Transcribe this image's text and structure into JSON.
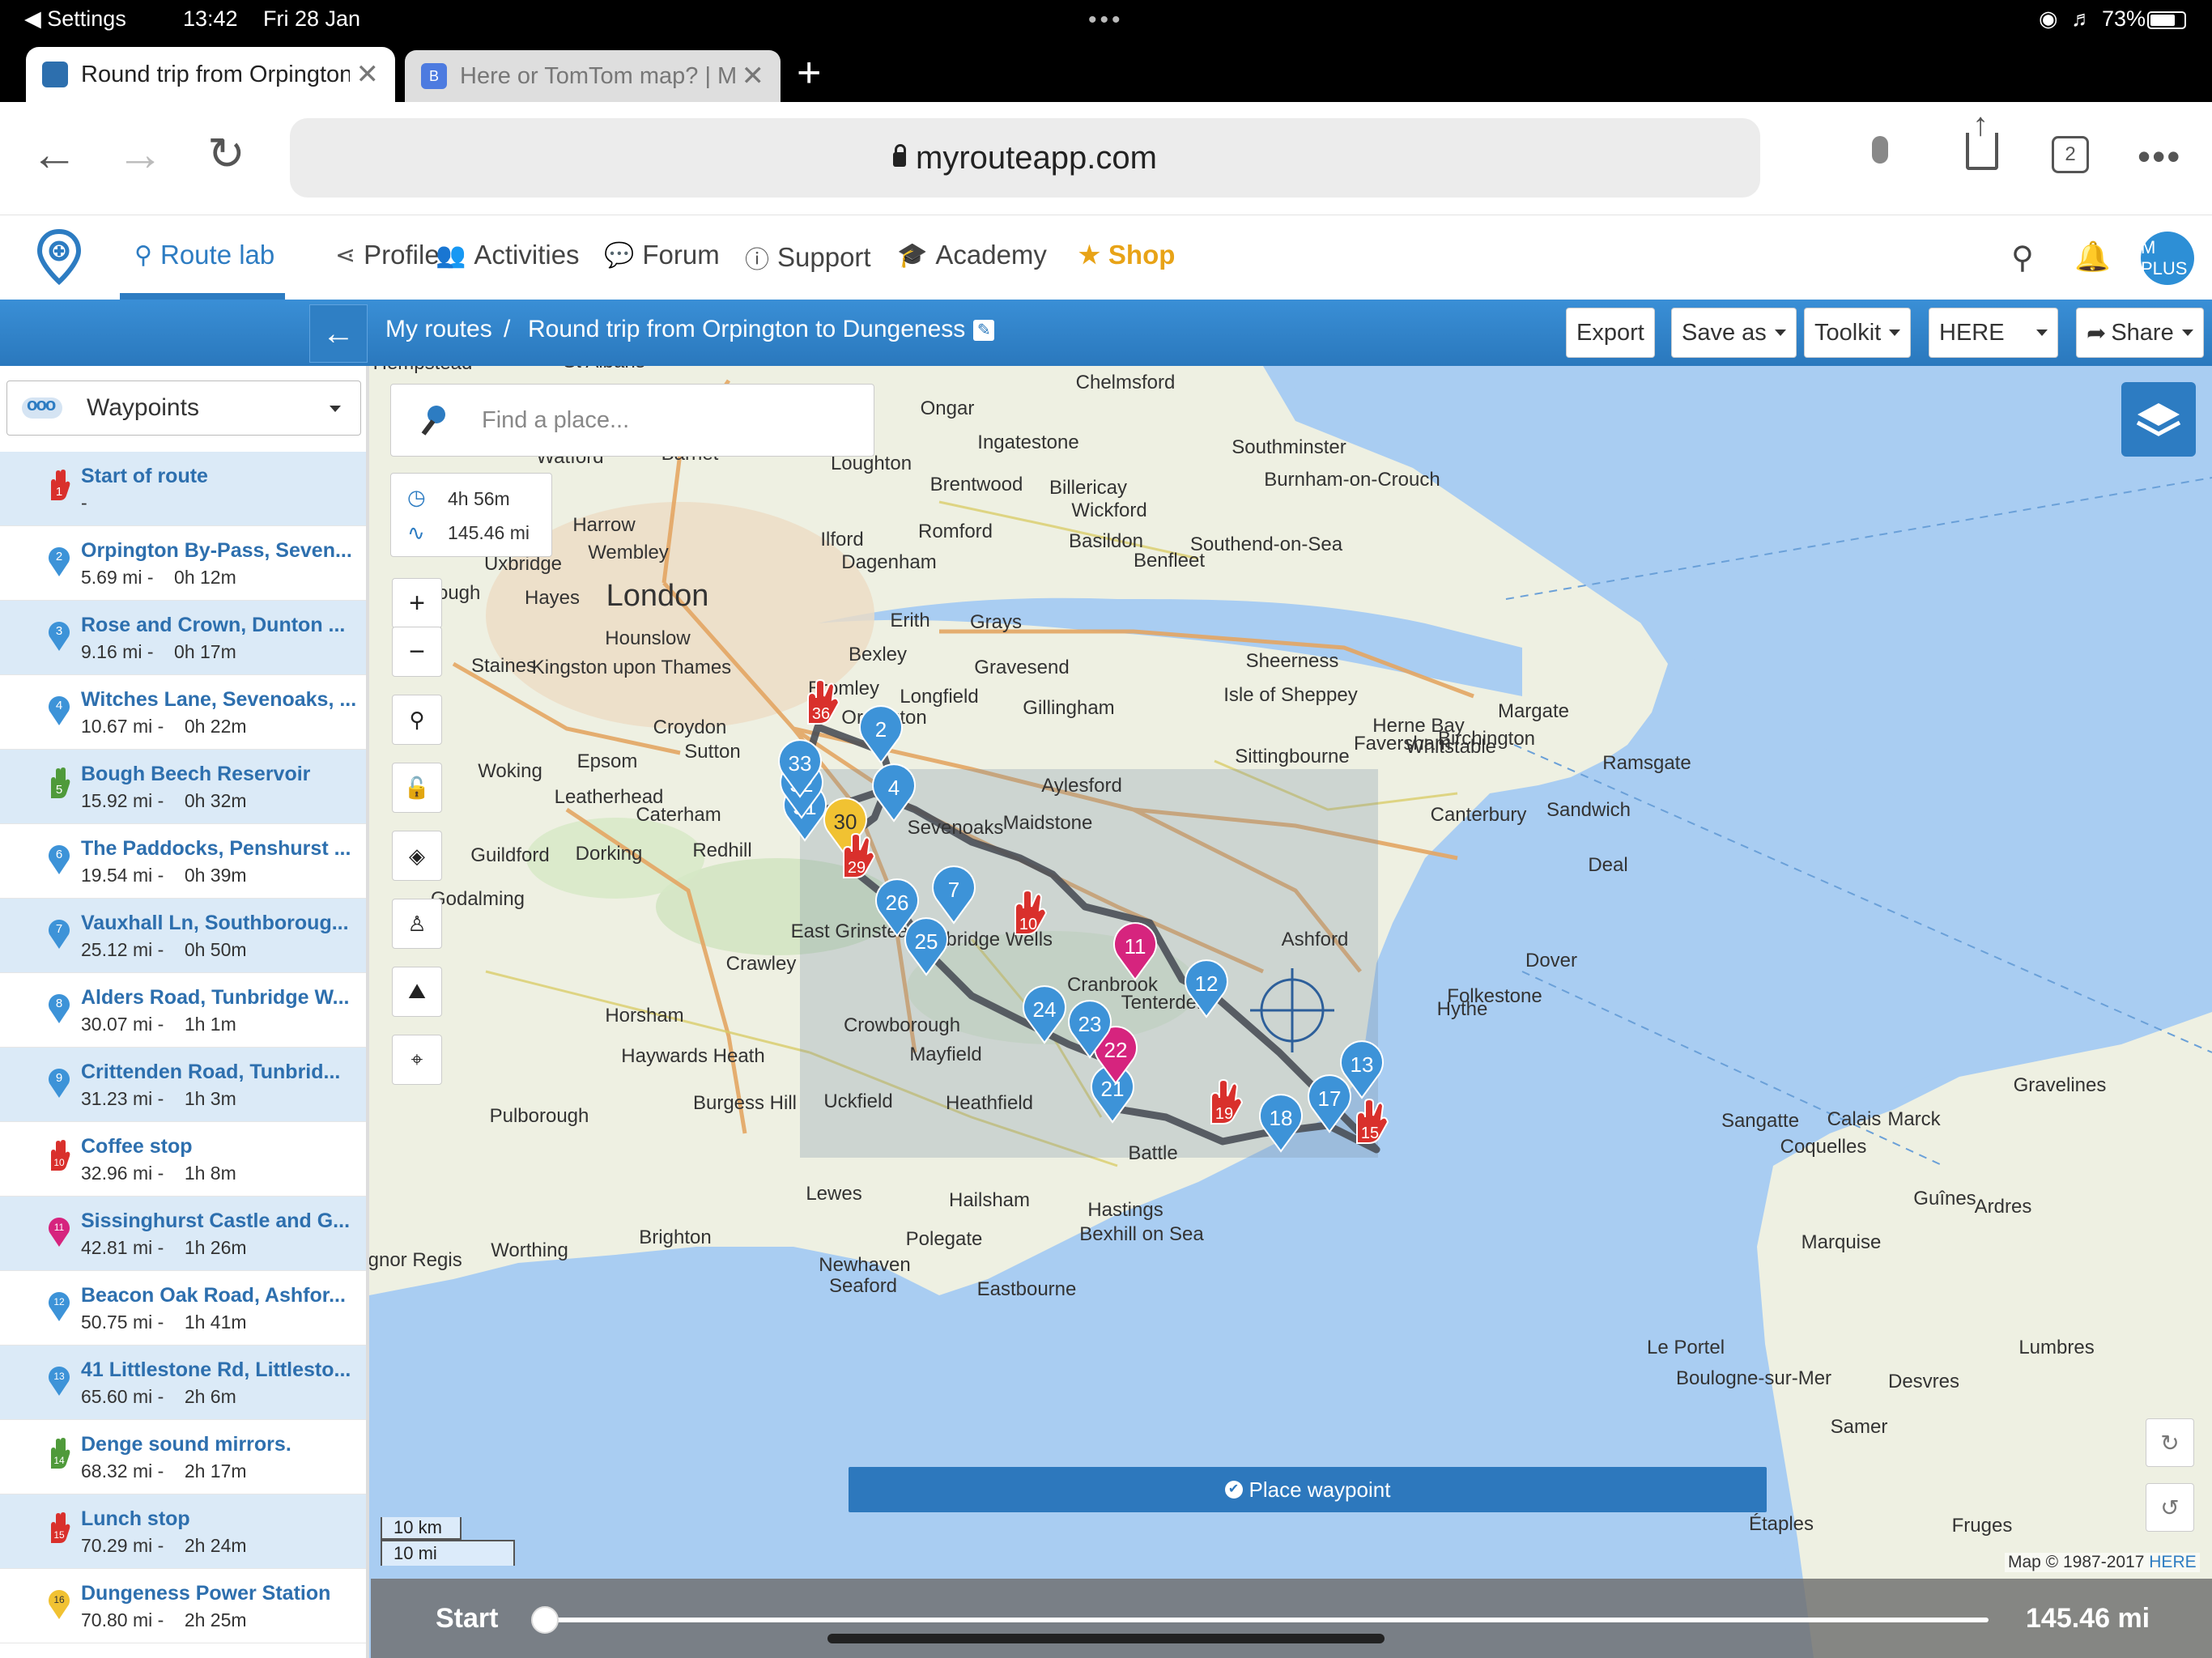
{
  "status_bar": {
    "back_app": "◀ Settings",
    "time": "13:42",
    "date": "Fri 28 Jan",
    "battery": "73%"
  },
  "browser_tabs": [
    {
      "title": "Round trip from Orpington",
      "active": true
    },
    {
      "title": "Here or TomTom map? | M",
      "active": false
    }
  ],
  "browser": {
    "url": "myrouteapp.com",
    "tab_count": "2"
  },
  "nav": {
    "items": [
      {
        "label": "Route lab",
        "icon": "map-pin-icon",
        "active": true
      },
      {
        "label": "Profile",
        "icon": "share-icon"
      },
      {
        "label": "Activities",
        "icon": "users-icon"
      },
      {
        "label": "Forum",
        "icon": "comments-icon"
      },
      {
        "label": "Support",
        "icon": "info-icon"
      },
      {
        "label": "Academy",
        "icon": "graduation-cap-icon"
      },
      {
        "label": "Shop",
        "icon": "star-icon",
        "accent": "#e8a317"
      }
    ],
    "avatar_text": "M PLUS"
  },
  "routebar": {
    "breadcrumb_root": "My routes",
    "separator": "/",
    "route_name": "Round trip from Orpington to Dungeness",
    "buttons": {
      "export": "Export",
      "save_as": "Save as",
      "toolkit": "Toolkit",
      "map_provider": "HERE",
      "share": "Share"
    }
  },
  "sidebar": {
    "dropdown_label": "Waypoints",
    "waypoints": [
      {
        "num": "1",
        "type": "hand",
        "color": "#d9302c",
        "title": "Start of route",
        "sub": "-"
      },
      {
        "num": "2",
        "type": "pin",
        "color": "#3d93d8",
        "title": "Orpington By-Pass, Seven...",
        "sub": "5.69 mi -    0h 12m"
      },
      {
        "num": "3",
        "type": "pin",
        "color": "#3d93d8",
        "title": "Rose and Crown, Dunton ...",
        "sub": "9.16 mi -    0h 17m"
      },
      {
        "num": "4",
        "type": "pin",
        "color": "#3d93d8",
        "title": "Witches Lane, Sevenoaks, ...",
        "sub": "10.67 mi -    0h 22m"
      },
      {
        "num": "5",
        "type": "hand",
        "color": "#4f9a3a",
        "title": "Bough Beech Reservoir",
        "sub": "15.92 mi -    0h 32m"
      },
      {
        "num": "6",
        "type": "pin",
        "color": "#3d93d8",
        "title": "The Paddocks, Penshurst ...",
        "sub": "19.54 mi -    0h 39m"
      },
      {
        "num": "7",
        "type": "pin",
        "color": "#3d93d8",
        "title": "Vauxhall Ln, Southboroug...",
        "sub": "25.12 mi -    0h 50m"
      },
      {
        "num": "8",
        "type": "pin",
        "color": "#3d93d8",
        "title": "Alders Road, Tunbridge W...",
        "sub": "30.07 mi -    1h 1m"
      },
      {
        "num": "9",
        "type": "pin",
        "color": "#3d93d8",
        "title": "Crittenden Road, Tunbrid...",
        "sub": "31.23 mi -    1h 3m"
      },
      {
        "num": "10",
        "type": "hand",
        "color": "#d9302c",
        "title": "Coffee stop",
        "sub": "32.96 mi -    1h 8m"
      },
      {
        "num": "11",
        "type": "pin",
        "color": "#d6247e",
        "title": "Sissinghurst Castle and G...",
        "sub": "42.81 mi -    1h 26m"
      },
      {
        "num": "12",
        "type": "pin",
        "color": "#3d93d8",
        "title": "Beacon Oak Road, Ashfor...",
        "sub": "50.75 mi -    1h 41m"
      },
      {
        "num": "13",
        "type": "pin",
        "color": "#3d93d8",
        "title": "41 Littlestone Rd, Littlesto...",
        "sub": "65.60 mi -    2h 6m"
      },
      {
        "num": "14",
        "type": "hand",
        "color": "#4f9a3a",
        "title": "Denge sound mirrors.",
        "sub": "68.32 mi -    2h 17m"
      },
      {
        "num": "15",
        "type": "hand",
        "color": "#d9302c",
        "title": "Lunch stop",
        "sub": "70.29 mi -    2h 24m"
      },
      {
        "num": "16",
        "type": "pin",
        "color": "#f1c232",
        "title": "Dungeness Power Station",
        "sub": "70.80 mi -    2h 25m"
      }
    ]
  },
  "map": {
    "search_placeholder": "Find a place...",
    "duration": "4h 56m",
    "distance": "145.46 mi",
    "zoom_in": "+",
    "zoom_out": "−",
    "place_waypoint": "Place waypoint",
    "scale_km": "10 km",
    "scale_mi": "10 mi",
    "copyright_prefix": "Map © 1987-2017",
    "copyright_brand": "HERE",
    "places": [
      {
        "name": "Chelmsford",
        "big": false
      },
      {
        "name": "London",
        "big": true
      },
      {
        "name": "Hounslow",
        "big": false
      },
      {
        "name": "Croydon",
        "big": false
      },
      {
        "name": "Sutton",
        "big": false
      },
      {
        "name": "Bexley",
        "big": false
      },
      {
        "name": "Romford",
        "big": false
      },
      {
        "name": "Basildon",
        "big": false
      },
      {
        "name": "Southend-on-Sea",
        "big": false
      },
      {
        "name": "Maidstone",
        "big": false
      },
      {
        "name": "Sevenoaks",
        "big": false
      },
      {
        "name": "Tunbridge Wells",
        "big": false
      },
      {
        "name": "Ashford",
        "big": false
      },
      {
        "name": "Canterbury",
        "big": false
      },
      {
        "name": "Dover",
        "big": false
      },
      {
        "name": "Folkestone",
        "big": false
      },
      {
        "name": "Margate",
        "big": false
      },
      {
        "name": "Ramsgate",
        "big": false
      },
      {
        "name": "Guildford",
        "big": false
      },
      {
        "name": "Crawley",
        "big": false
      },
      {
        "name": "Horsham",
        "big": false
      },
      {
        "name": "Brighton",
        "big": false
      },
      {
        "name": "Worthing",
        "big": false
      },
      {
        "name": "Eastbourne",
        "big": false
      },
      {
        "name": "Hastings",
        "big": false
      },
      {
        "name": "Bexhill on Sea",
        "big": false
      },
      {
        "name": "Calais",
        "big": false
      },
      {
        "name": "Woking",
        "big": false
      },
      {
        "name": "Gravesend",
        "big": false
      },
      {
        "name": "Sittingbourne",
        "big": false
      },
      {
        "name": "Faversham",
        "big": false
      },
      {
        "name": "Deal",
        "big": false
      },
      {
        "name": "Hythe",
        "big": false
      },
      {
        "name": "Battle",
        "big": false
      },
      {
        "name": "Lewes",
        "big": false
      },
      {
        "name": "Hailsham",
        "big": false
      },
      {
        "name": "Heathfield",
        "big": false
      },
      {
        "name": "Crowborough",
        "big": false
      },
      {
        "name": "Mayfield",
        "big": false
      },
      {
        "name": "Uckfield",
        "big": false
      },
      {
        "name": "Burgess Hill",
        "big": false
      },
      {
        "name": "Haywards Heath",
        "big": false
      },
      {
        "name": "East Grinstead",
        "big": false
      },
      {
        "name": "Redhill",
        "big": false
      },
      {
        "name": "Dorking",
        "big": false
      },
      {
        "name": "Epsom",
        "big": false
      },
      {
        "name": "Kingston upon Thames",
        "big": false
      },
      {
        "name": "Slough",
        "big": false
      },
      {
        "name": "Uxbridge",
        "big": false
      },
      {
        "name": "Harrow",
        "big": false
      },
      {
        "name": "Wembley",
        "big": false
      },
      {
        "name": "Ilford",
        "big": false
      },
      {
        "name": "Dagenham",
        "big": false
      },
      {
        "name": "Brentwood",
        "big": false
      },
      {
        "name": "Billericay",
        "big": false
      },
      {
        "name": "Grays",
        "big": false
      },
      {
        "name": "Sheerness",
        "big": false
      },
      {
        "name": "Isle of Sheppey",
        "big": false
      },
      {
        "name": "Herne Bay",
        "big": false
      },
      {
        "name": "Whitstable",
        "big": false
      },
      {
        "name": "Sandwich",
        "big": false
      },
      {
        "name": "Tenterden",
        "big": false
      },
      {
        "name": "Cranbrook",
        "big": false
      },
      {
        "name": "Gillingham",
        "big": false
      },
      {
        "name": "Aylesford",
        "big": false
      },
      {
        "name": "Longfield",
        "big": false
      },
      {
        "name": "Erith",
        "big": false
      },
      {
        "name": "Bromley",
        "big": false
      },
      {
        "name": "Orpington",
        "big": false
      },
      {
        "name": "Leatherhead",
        "big": false
      },
      {
        "name": "Caterham",
        "big": false
      },
      {
        "name": "Godalming",
        "big": false
      },
      {
        "name": "Pulborough",
        "big": false
      },
      {
        "name": "Bognor Regis",
        "big": false
      },
      {
        "name": "Newhaven",
        "big": false
      },
      {
        "name": "Seaford",
        "big": false
      },
      {
        "name": "Polegate",
        "big": false
      },
      {
        "name": "Boulogne-sur-Mer",
        "big": false
      },
      {
        "name": "Marquise",
        "big": false
      },
      {
        "name": "Guînes",
        "big": false
      },
      {
        "name": "Ardres",
        "big": false
      },
      {
        "name": "Gravelines",
        "big": false
      },
      {
        "name": "Marck",
        "big": false
      },
      {
        "name": "Coquelles",
        "big": false
      },
      {
        "name": "Sangatte",
        "big": false
      },
      {
        "name": "Le Portel",
        "big": false
      },
      {
        "name": "Desvres",
        "big": false
      },
      {
        "name": "Samer",
        "big": false
      },
      {
        "name": "Étaples",
        "big": false
      },
      {
        "name": "Lumbres",
        "big": false
      },
      {
        "name": "Fruges",
        "big": false
      },
      {
        "name": "Southminster",
        "big": false
      },
      {
        "name": "Burnham-on-Crouch",
        "big": false
      },
      {
        "name": "Birchington",
        "big": false
      },
      {
        "name": "Wickford",
        "big": false
      },
      {
        "name": "Benfleet",
        "big": false
      },
      {
        "name": "Barnet",
        "big": false
      },
      {
        "name": "Watford",
        "big": false
      },
      {
        "name": "St Albans",
        "big": false
      },
      {
        "name": "Hempstead",
        "big": false
      },
      {
        "name": "Loughton",
        "big": false
      },
      {
        "name": "Ongar",
        "big": false
      },
      {
        "name": "Ingatestone",
        "big": false
      },
      {
        "name": "Staines",
        "big": false
      },
      {
        "name": "Hayes",
        "big": false
      }
    ],
    "pins": [
      {
        "num": "2",
        "color": "#3d93d8"
      },
      {
        "num": "4",
        "color": "#3d93d8"
      },
      {
        "num": "7",
        "color": "#3d93d8"
      },
      {
        "num": "11",
        "color": "#d6247e"
      },
      {
        "num": "12",
        "color": "#3d93d8"
      },
      {
        "num": "13",
        "color": "#3d93d8"
      },
      {
        "num": "17",
        "color": "#3d93d8"
      },
      {
        "num": "18",
        "color": "#3d93d8"
      },
      {
        "num": "21",
        "color": "#3d93d8"
      },
      {
        "num": "22",
        "color": "#d6247e"
      },
      {
        "num": "23",
        "color": "#3d93d8"
      },
      {
        "num": "24",
        "color": "#3d93d8"
      },
      {
        "num": "25",
        "color": "#3d93d8"
      },
      {
        "num": "26",
        "color": "#3d93d8"
      },
      {
        "num": "30",
        "color": "#f1c232"
      },
      {
        "num": "31",
        "color": "#3d93d8"
      },
      {
        "num": "32",
        "color": "#3d93d8"
      },
      {
        "num": "33",
        "color": "#3d93d8"
      }
    ],
    "stops": [
      {
        "num": "36",
        "color": "#d9302c"
      },
      {
        "num": "10",
        "color": "#d9302c"
      },
      {
        "num": "15",
        "color": "#d9302c"
      },
      {
        "num": "29",
        "color": "#d9302c"
      },
      {
        "num": "19",
        "color": "#d9302c"
      }
    ]
  },
  "slider": {
    "start_label": "Start",
    "end_label": "145.46 mi",
    "position": 0.0
  }
}
